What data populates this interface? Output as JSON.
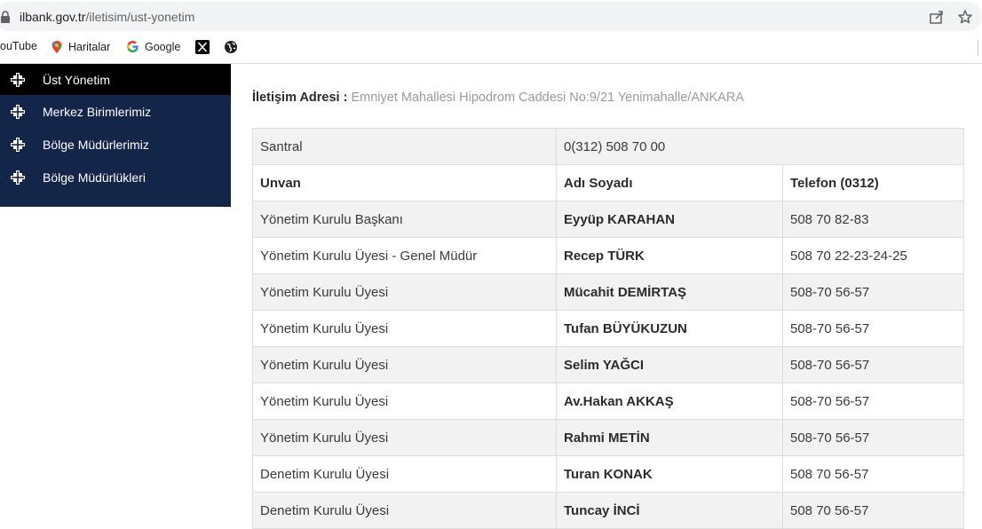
{
  "browser": {
    "url_domain": "ilbank.gov.tr",
    "url_path": "/iletisim/ust-yonetim",
    "bookmarks": [
      "ouTube",
      "Haritalar",
      "Google",
      "X",
      "globe"
    ]
  },
  "sidebar": {
    "items": [
      {
        "label": "Üst Yönetim",
        "active": true
      },
      {
        "label": "Merkez Birimlerimiz",
        "active": false
      },
      {
        "label": "Bölge Müdürlerimiz",
        "active": false
      },
      {
        "label": "Bölge Müdürlükleri",
        "active": false
      }
    ]
  },
  "contact": {
    "address_label": "İletişim Adresi :",
    "address_value": "Emniyet Mahallesi Hipodrom Caddesi No:9/21 Yenimahalle/ANKARA"
  },
  "table": {
    "santral_label": "Santral",
    "santral_value": "0(312) 508 70 00",
    "headers": [
      "Unvan",
      "Adı Soyadı",
      "Telefon (0312)"
    ],
    "rows": [
      {
        "title": "Yönetim Kurulu Başkanı",
        "name": "Eyyüp KARAHAN",
        "phone": "508 70 82-83"
      },
      {
        "title": "Yönetim Kurulu Üyesi - Genel Müdür",
        "name": "Recep TÜRK",
        "phone": "508 70 22-23-24-25"
      },
      {
        "title": "Yönetim Kurulu Üyesi",
        "name": "Mücahit DEMİRTAŞ",
        "phone": "508-70 56-57"
      },
      {
        "title": "Yönetim Kurulu Üyesi",
        "name": "Tufan BÜYÜKUZUN",
        "phone": "508-70 56-57"
      },
      {
        "title": "Yönetim Kurulu Üyesi",
        "name": "Selim YAĞCI",
        "phone": "508-70 56-57"
      },
      {
        "title": "Yönetim Kurulu Üyesi",
        "name": "Av.Hakan AKKAŞ",
        "phone": "508-70 56-57"
      },
      {
        "title": "Yönetim Kurulu Üyesi",
        "name": "Rahmi METİN",
        "phone": "508-70 56-57"
      },
      {
        "title": "Denetim Kurulu Üyesi",
        "name": "Turan KONAK",
        "phone": "508 70 56-57"
      },
      {
        "title": "Denetim Kurulu Üyesi",
        "name": "Tuncay İNCİ",
        "phone": "508 70 56-57"
      }
    ]
  }
}
